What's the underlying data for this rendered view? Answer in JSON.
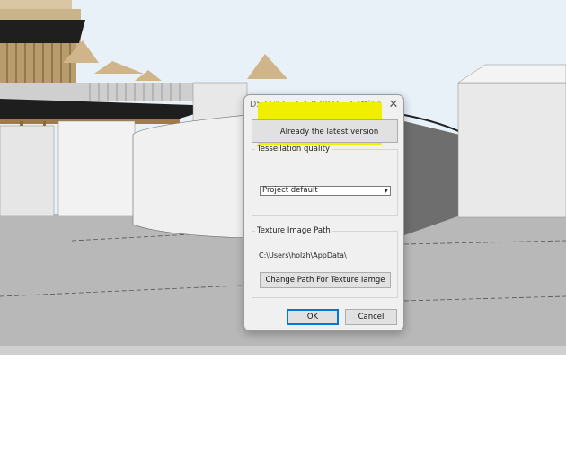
{
  "dialog": {
    "title": "D5 Sync - 1.1.0.0016 - Setting",
    "close_icon": "close-icon",
    "version_button_label": "Already the latest version",
    "tessellation": {
      "group_label": "Tessellation quality",
      "selected_option": "Project default"
    },
    "texture": {
      "group_label": "Texture Image Path",
      "path_value": "C:\\Users\\holzh\\AppData\\",
      "change_button_label": "Change Path For Texture Iamge"
    },
    "ok_label": "OK",
    "cancel_label": "Cancel"
  },
  "colors": {
    "highlight": "#f2ee00",
    "dialog_bg": "#f0f0f0",
    "sky": "#e6f0f8",
    "ground": "#b9b9b9"
  }
}
